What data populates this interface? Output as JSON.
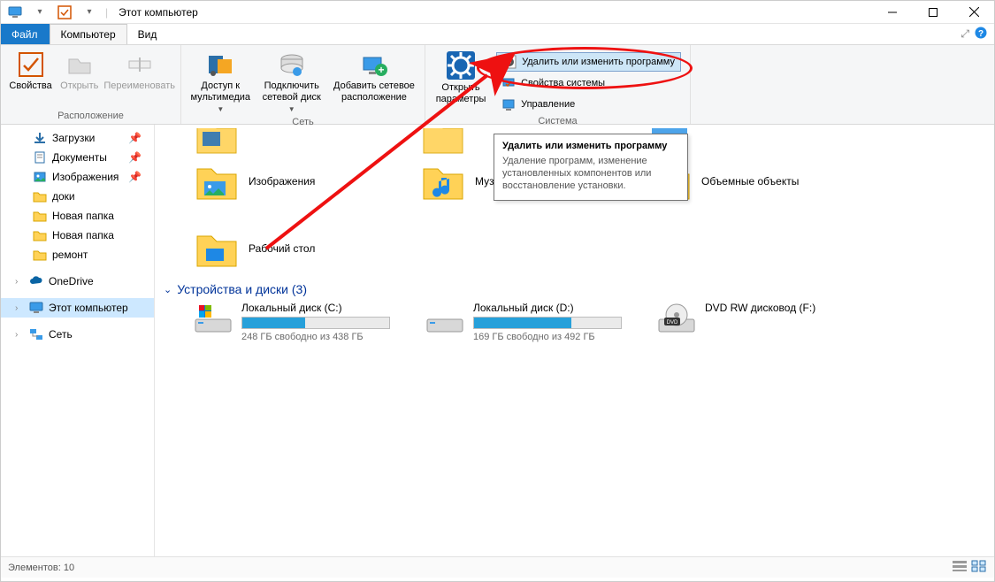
{
  "title": "Этот компьютер",
  "tabs": {
    "file": "Файл",
    "computer": "Компьютер",
    "view": "Вид"
  },
  "ribbon": {
    "group_location": "Расположение",
    "group_network": "Сеть",
    "group_system": "Система",
    "props": "Свойства",
    "open": "Открыть",
    "rename": "Переименовать",
    "media_access": "Доступ к\nмультимедиа",
    "map_drive": "Подключить\nсетевой диск",
    "add_net_loc": "Добавить сетевое\nрасположение",
    "open_settings": "Открыть\nпараметры",
    "uninstall": "Удалить или изменить программу",
    "sys_props": "Свойства системы",
    "manage": "Управление"
  },
  "nav": {
    "downloads": "Загрузки",
    "documents": "Документы",
    "pictures": "Изображения",
    "doki": "доки",
    "new_folder": "Новая папка",
    "new_folder2": "Новая папка",
    "remont": "ремонт",
    "onedrive": "OneDrive",
    "this_pc": "Этот компьютер",
    "network": "Сеть"
  },
  "folders": {
    "pictures": "Изображения",
    "music": "Музык",
    "objects3d": "Объемные объекты",
    "desktop": "Рабочий стол"
  },
  "section_devices": "Устройства и диски (3)",
  "drives": {
    "c": {
      "label": "Локальный диск (C:)",
      "subtext": "248 ГБ свободно из 438 ГБ",
      "fill_pct": 43
    },
    "d": {
      "label": "Локальный диск (D:)",
      "subtext": "169 ГБ свободно из 492 ГБ",
      "fill_pct": 66
    },
    "dvd": {
      "label": "DVD RW дисковод (F:)"
    }
  },
  "tooltip": {
    "title": "Удалить или изменить программу",
    "body": "Удаление программ, изменение установленных компонентов или восстановление установки."
  },
  "statusbar": {
    "items": "Элементов: 10"
  }
}
